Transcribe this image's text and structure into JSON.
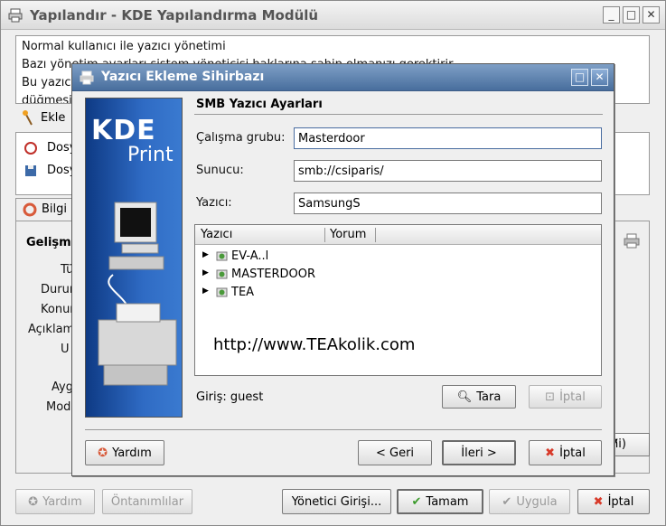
{
  "window": {
    "title": "Yapılandır - KDE Yapılandırma Modülü",
    "info_lines": [
      "Normal kullanıcı ile yazıcı yönetimi",
      "Bazı yönetim ayarları sistem yöneticisi haklarına sahip olmanızı gerektirir.",
      "Bu yazıcı",
      "düğmesi"
    ],
    "toolbar_label": "Ekle",
    "list_items": [
      "Dosy",
      "Dosy"
    ],
    "tab_label": "Bilgi",
    "group_title": "Gelişm",
    "field_labels": [
      "Tü",
      "Durum",
      "Konum",
      "Açıklam",
      "U",
      "Ayg",
      "Mod"
    ],
    "combo_value": "ni)",
    "bottom_buttons": {
      "help": "Yardım",
      "defaults": "Öntanımlılar",
      "admin": "Yönetici Girişi...",
      "ok": "Tamam",
      "apply": "Uygula",
      "cancel": "İptal"
    }
  },
  "dialog": {
    "title": "Yazıcı Ekleme Sihirbazı",
    "side_logo_1": "KDE",
    "side_logo_2": "Print",
    "section_title": "SMB Yazıcı Ayarları",
    "workgroup_label": "Çalışma grubu:",
    "workgroup_value": "Masterdoor",
    "server_label": "Sunucu:",
    "server_value": "smb://csiparis/",
    "printer_label": "Yazıcı:",
    "printer_value": "SamsungS",
    "tree": {
      "col_printer": "Yazıcı",
      "col_comment": "Yorum",
      "rows": [
        "EV-A..l",
        "MASTERDOOR",
        "TEA"
      ]
    },
    "watermark": "http://www.TEAkolik.com",
    "login_text": "Giriş: guest",
    "scan_button": "Tara",
    "abort_button": "İptal",
    "help_button": "Yardım",
    "back_button": "< Geri",
    "next_button": "İleri >",
    "cancel_button": "İptal"
  },
  "colors": {
    "dialog_title": "#486e9d",
    "side_panel": "#2f6bc4",
    "cancel_icon": "#d83a2a",
    "ok_icon": "#3a9a2a"
  }
}
